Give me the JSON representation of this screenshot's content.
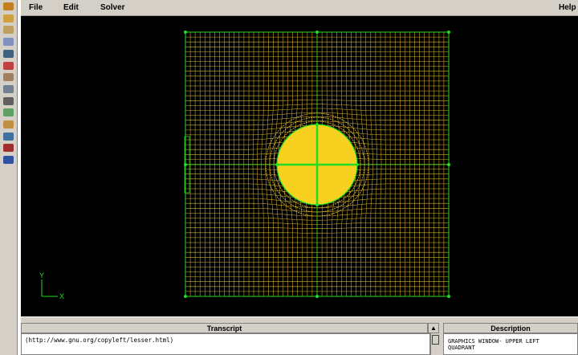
{
  "menubar": {
    "file": "File",
    "edit": "Edit",
    "solver": "Solver",
    "help": "Help"
  },
  "toolbar": {
    "tools": [
      {
        "name": "tool-1-icon",
        "color": "#c08020"
      },
      {
        "name": "tool-2-icon",
        "color": "#d0a040"
      },
      {
        "name": "tool-3-icon",
        "color": "#c0a060"
      },
      {
        "name": "tool-4-icon",
        "color": "#8090c0"
      },
      {
        "name": "tool-5-icon",
        "color": "#406080"
      },
      {
        "name": "tool-6-icon",
        "color": "#c04040"
      },
      {
        "name": "tool-7-icon",
        "color": "#a08060"
      },
      {
        "name": "tool-8-icon",
        "color": "#708090"
      },
      {
        "name": "tool-9-icon",
        "color": "#606060"
      },
      {
        "name": "tool-10-icon",
        "color": "#60a060"
      },
      {
        "name": "tool-11-icon",
        "color": "#c09040"
      },
      {
        "name": "tool-12-icon",
        "color": "#4070a0"
      },
      {
        "name": "tool-13-icon",
        "color": "#a03030"
      },
      {
        "name": "tool-14-icon",
        "color": "#3050a0"
      }
    ]
  },
  "graphics": {
    "axis_y": "Y",
    "axis_x": "X",
    "mesh_color": "#e8c232",
    "edge_color": "#22dd22",
    "circle_fill": "#f8d020"
  },
  "transcript": {
    "title": "Transcript",
    "text": "(http://www.gnu.org/copyleft/lesser.html)"
  },
  "description": {
    "title": "Description",
    "text": "GRAPHICS WINDOW- UPPER LEFT\nQUADRANT"
  }
}
